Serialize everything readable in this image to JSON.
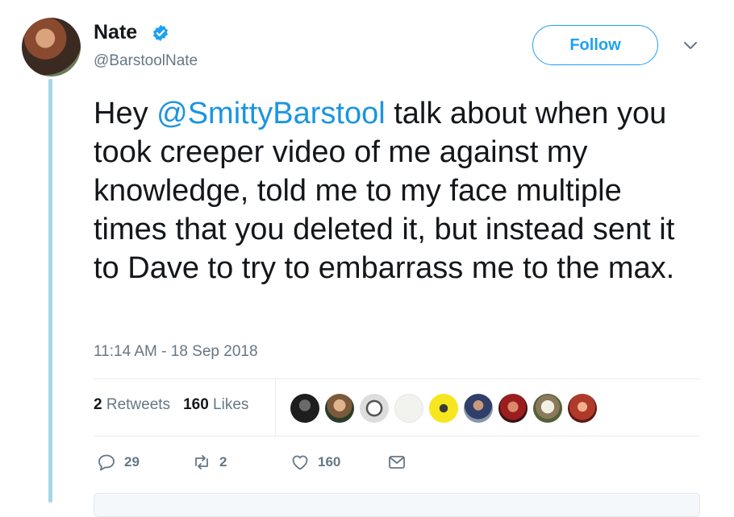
{
  "user": {
    "name": "Nate",
    "handle": "@BarstoolNate",
    "verified": true
  },
  "follow_button": {
    "label": "Follow"
  },
  "tweet": {
    "pre": "Hey ",
    "mention": "@SmittyBarstool",
    "post": " talk about when you took creeper video of me against my knowledge, told me to my face multiple times that you deleted it, but instead sent it to Dave to try to embarrass me to the max."
  },
  "timestamp": "11:14 AM - 18 Sep 2018",
  "stats": {
    "retweets_count": "2",
    "retweets_label": "Retweets",
    "likes_count": "160",
    "likes_label": "Likes"
  },
  "actions": {
    "reply_count": "29",
    "retweet_count": "2",
    "like_count": "160"
  },
  "colors": {
    "accent": "#1da1f2",
    "mention": "#1b95e0",
    "thread_line": "#a6d5e8",
    "muted": "#657786"
  },
  "likers": [
    "liker-avatar",
    "liker-avatar",
    "liker-avatar",
    "liker-avatar",
    "liker-avatar",
    "liker-avatar",
    "liker-avatar",
    "liker-avatar",
    "liker-avatar"
  ]
}
